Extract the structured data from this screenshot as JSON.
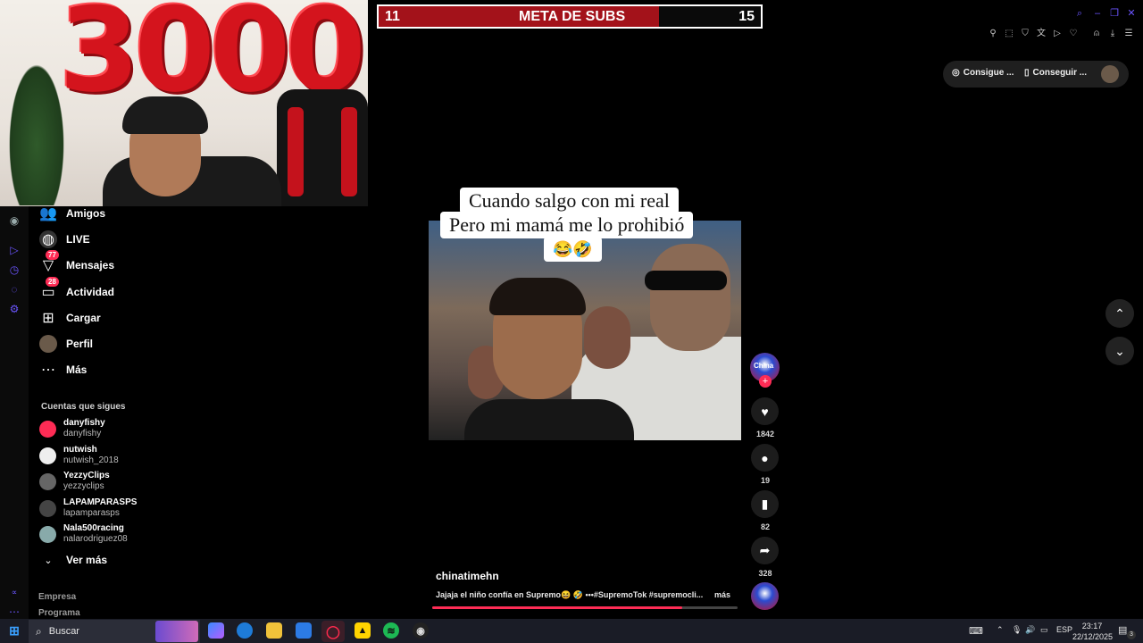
{
  "webcam": {
    "balloon_text": "3000"
  },
  "subgoal": {
    "current": "11",
    "title": "META DE SUBS",
    "target": "15",
    "progress_fraction": 0.7333
  },
  "sidebar": {
    "nav": [
      {
        "label": "Amigos",
        "icon": "friends-icon"
      },
      {
        "label": "LIVE",
        "icon": "live-icon"
      },
      {
        "label": "Mensajes",
        "icon": "messages-icon",
        "badge": "77"
      },
      {
        "label": "Actividad",
        "icon": "activity-icon",
        "badge": "28"
      },
      {
        "label": "Cargar",
        "icon": "upload-icon"
      },
      {
        "label": "Perfil",
        "icon": "profile-avatar"
      },
      {
        "label": "Más",
        "icon": "more-icon"
      }
    ],
    "following_title": "Cuentas que sigues",
    "following": [
      {
        "display": "danyfishy",
        "handle": "danyfishy"
      },
      {
        "display": "nutwish",
        "handle": "nutwish_2018"
      },
      {
        "display": "YezzyClips",
        "handle": "yezzyclips"
      },
      {
        "display": "LAPAMPARASPS",
        "handle": "lapamparasps"
      },
      {
        "display": "Nala500racing",
        "handle": "nalarodriguez08"
      }
    ],
    "see_more": "Ver más",
    "footer": [
      "Empresa",
      "Programa"
    ]
  },
  "topbar": {
    "consigue_label": "Consigue ...",
    "conseguir_label": "Conseguir ..."
  },
  "video": {
    "caption_lines": [
      "Cuando salgo con mi real",
      "Pero mi mamá me lo prohibió",
      "😂🤣"
    ],
    "author": "chinatimehn",
    "description": "Jajaja el niño confía en Supremo😆 🤣 •••#SupremoTok #supremocli...",
    "more_label": "más",
    "likes": "1842",
    "comments": "19",
    "saves": "82",
    "shares": "328",
    "creator_avatar_text": "China",
    "progress_fraction": 0.82
  },
  "taskbar": {
    "search_placeholder": "Buscar",
    "lang": "ESP",
    "time": "23:17",
    "date": "22/12/2025",
    "notif_count": "3"
  },
  "colors": {
    "accent": "#fe2c55",
    "rail_icon": "#6b55ff",
    "subgoal_fill": "#a3121a"
  }
}
